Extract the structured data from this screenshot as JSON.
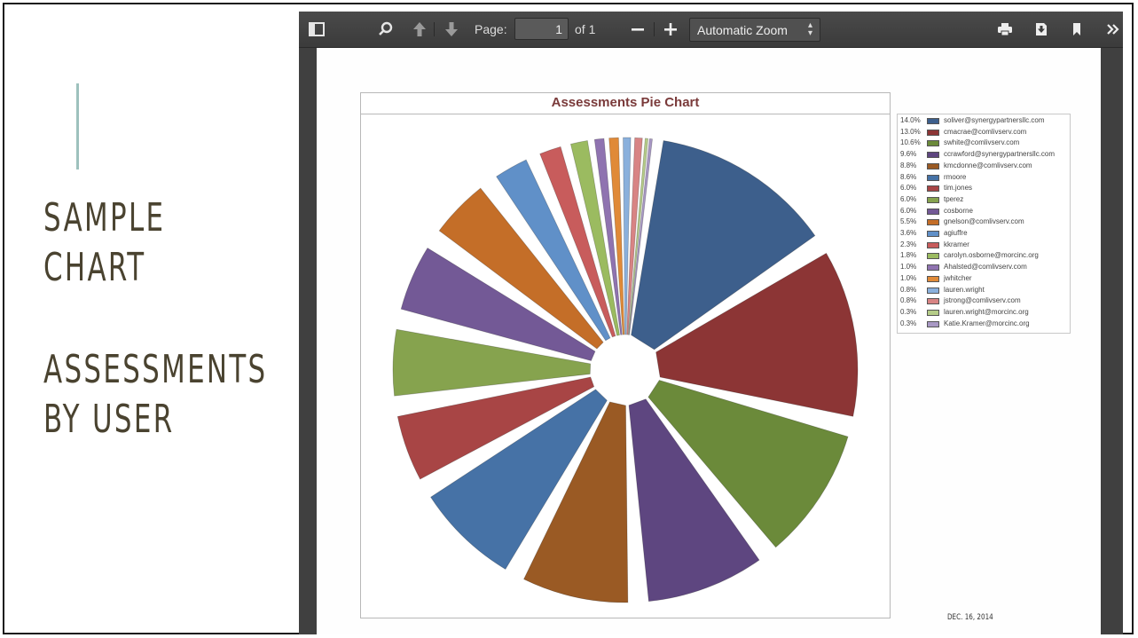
{
  "slide": {
    "title_lines": [
      "SAMPLE",
      "CHART"
    ],
    "subtitle_lines": [
      "ASSESSMENTS",
      "BY USER"
    ],
    "accent_color": "#9ec1bd",
    "text_color": "#4a4330"
  },
  "viewer": {
    "page_label": "Page:",
    "page_value": "1",
    "page_of": "of 1",
    "zoom_value": "Automatic Zoom",
    "icons": [
      "sidebar-toggle-icon",
      "search-icon",
      "previous-page-icon",
      "next-page-icon",
      "zoom-out-icon",
      "zoom-in-icon",
      "print-icon",
      "download-icon",
      "bookmark-icon",
      "more-tools-icon"
    ]
  },
  "document": {
    "footer_date": "DEC. 16, 2014"
  },
  "chart_data": {
    "type": "pie",
    "title": "Assessments Pie Chart",
    "exploded": true,
    "legend_position": "right",
    "slices": [
      {
        "label": "soliver@synergypartnersllc.com",
        "percent_label": "14.0%",
        "value": 14.0,
        "color": "#3d5f8c"
      },
      {
        "label": "cmacrae@comlivserv.com",
        "percent_label": "13.0%",
        "value": 13.0,
        "color": "#8c3535"
      },
      {
        "label": "swhite@comlivserv.com",
        "percent_label": "10.6%",
        "value": 10.6,
        "color": "#6b8a3a"
      },
      {
        "label": "ccrawford@synergypartnersllc.com",
        "percent_label": "9.6%",
        "value": 9.6,
        "color": "#5e4680"
      },
      {
        "label": "kmcdonne@comlivserv.com",
        "percent_label": "8.8%",
        "value": 8.8,
        "color": "#9a5a24"
      },
      {
        "label": "rmoore",
        "percent_label": "8.6%",
        "value": 8.6,
        "color": "#4672a6"
      },
      {
        "label": "tim.jones",
        "percent_label": "6.0%",
        "value": 6.0,
        "color": "#a84545"
      },
      {
        "label": "tperez",
        "percent_label": "6.0%",
        "value": 6.0,
        "color": "#86a34e"
      },
      {
        "label": "cosborne",
        "percent_label": "6.0%",
        "value": 6.0,
        "color": "#735996"
      },
      {
        "label": "gnelson@comlivserv.com",
        "percent_label": "5.5%",
        "value": 5.5,
        "color": "#c46e28"
      },
      {
        "label": "agiuffre",
        "percent_label": "3.6%",
        "value": 3.6,
        "color": "#6090c8"
      },
      {
        "label": "kkramer",
        "percent_label": "2.3%",
        "value": 2.3,
        "color": "#c85c5c"
      },
      {
        "label": "carolyn.osborne@morcinc.org",
        "percent_label": "1.8%",
        "value": 1.8,
        "color": "#9bbb60"
      },
      {
        "label": "Ahalsted@comlivserv.com",
        "percent_label": "1.0%",
        "value": 1.0,
        "color": "#8f73b0"
      },
      {
        "label": "jwhitcher",
        "percent_label": "1.0%",
        "value": 1.0,
        "color": "#e08a38"
      },
      {
        "label": "lauren.wright",
        "percent_label": "0.8%",
        "value": 0.8,
        "color": "#8ab0dc"
      },
      {
        "label": "jstrong@comlivserv.com",
        "percent_label": "0.8%",
        "value": 0.8,
        "color": "#d88484"
      },
      {
        "label": "lauren.wright@morcinc.org",
        "percent_label": "0.3%",
        "value": 0.3,
        "color": "#b5cc88"
      },
      {
        "label": "Katie.Kramer@morcinc.org",
        "percent_label": "0.3%",
        "value": 0.3,
        "color": "#a898c4"
      }
    ]
  }
}
